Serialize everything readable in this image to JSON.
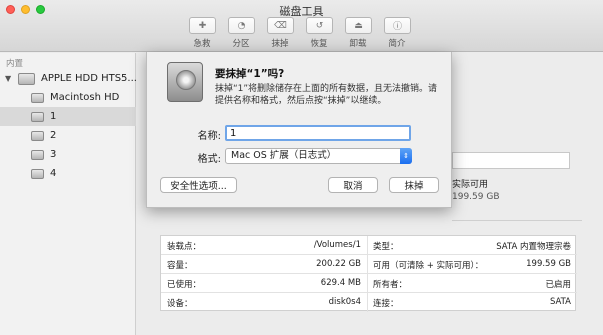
{
  "window": {
    "title": "磁盘工具"
  },
  "toolbar": {
    "items": [
      {
        "label": "急救",
        "icon": "first-aid-icon"
      },
      {
        "label": "分区",
        "icon": "partition-icon"
      },
      {
        "label": "抹掉",
        "icon": "erase-icon"
      },
      {
        "label": "恢复",
        "icon": "restore-icon"
      },
      {
        "label": "卸载",
        "icon": "unmount-icon"
      },
      {
        "label": "简介",
        "icon": "info-icon"
      }
    ]
  },
  "sidebar": {
    "header": "内置",
    "drive": "APPLE HDD HTS5...",
    "items": [
      {
        "label": "Macintosh HD"
      },
      {
        "label": "1"
      },
      {
        "label": "2"
      },
      {
        "label": "3"
      },
      {
        "label": "4"
      }
    ]
  },
  "dialog": {
    "title": "要抹掉“1”吗?",
    "message": "抹掉“1”将删除储存在上面的所有数据，且无法撤销。请提供名称和格式，然后点按“抹掉”以继续。",
    "name_label": "名称:",
    "name_value": "1",
    "format_label": "格式:",
    "format_value": "Mac OS 扩展（日志式）",
    "security_button": "安全性选项...",
    "cancel_button": "取消",
    "erase_button": "抹掉"
  },
  "right_panel": {
    "avail_label": "实际可用",
    "avail_value": "199.59 GB"
  },
  "info": {
    "rows": [
      {
        "k1": "装载点：",
        "v1": "/Volumes/1",
        "k2": "类型：",
        "v2": "SATA 内置物理宗卷"
      },
      {
        "k1": "容量：",
        "v1": "200.22 GB",
        "k2": "可用（可清除 + 实际可用）：",
        "v2": "199.59 GB"
      },
      {
        "k1": "已使用：",
        "v1": "629.4 MB",
        "k2": "所有者：",
        "v2": "已启用"
      },
      {
        "k1": "设备：",
        "v1": "disk0s4",
        "k2": "连接：",
        "v2": "SATA"
      }
    ]
  },
  "colors": {
    "accent": "#1a6ef0",
    "focus_ring": "#6fa5e8",
    "selection": "#d9d9d9"
  }
}
